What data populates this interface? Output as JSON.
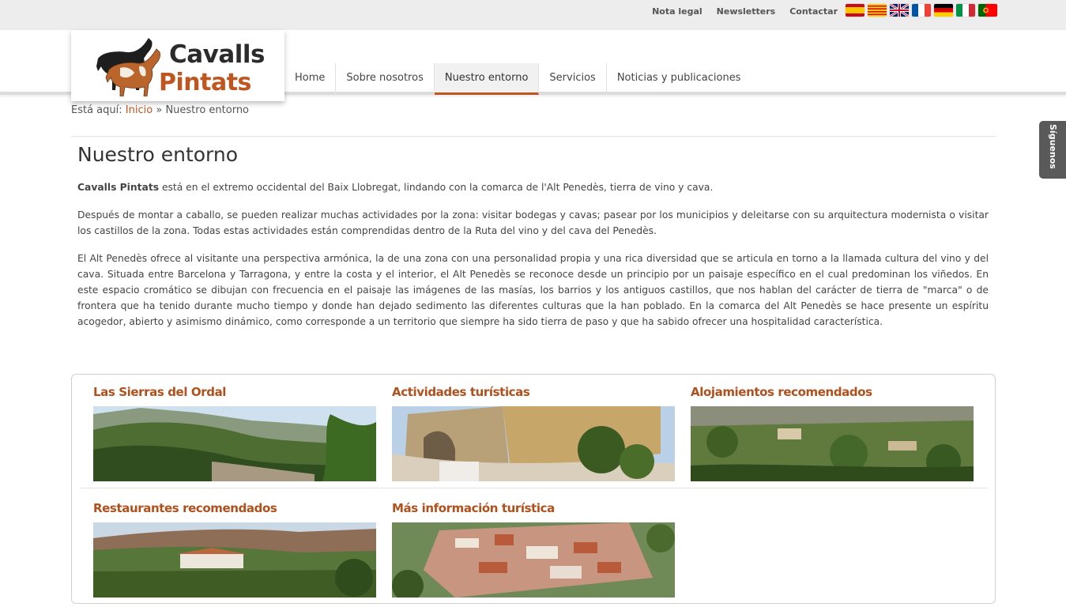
{
  "toplinks": [
    "Nota legal",
    "Newsletters",
    "Contactar"
  ],
  "flags": [
    "spanish-flag-icon",
    "catalan-flag-icon",
    "uk-flag-icon",
    "french-flag-icon",
    "german-flag-icon",
    "italian-flag-icon",
    "portuguese-flag-icon"
  ],
  "logo": {
    "line1": "Cavalls",
    "line2": "Pintats"
  },
  "nav": [
    "Home",
    "Sobre nosotros",
    "Nuestro entorno",
    "Servicios",
    "Noticias y publicaciones"
  ],
  "nav_active": "Nuestro entorno",
  "breadcrumb": {
    "prefix": "Está aquí:",
    "home": "Inicio",
    "sep": "»",
    "current": "Nuestro entorno"
  },
  "page": {
    "title": "Nuestro entorno",
    "p1_bold": "Cavalls Pintats",
    "p1_rest": " está en el extremo occidental del Baix Llobregat, lindando con la comarca de l'Alt Penedès, tierra de vino y cava.",
    "p2": "Después de montar a caballo, se pueden realizar muchas actividades por la zona: visitar bodegas y cavas; pasear por los municipios y deleitarse con su arquitectura modernista o visitar los castillos de la zona. Todas estas actividades están comprendidas dentro de la Ruta del vino y del cava del Penedès.",
    "p3": "El Alt Penedès ofrece al visitante una perspectiva armónica, la de una zona con una personalidad propia y una rica diversidad que se articula en torno a la llamada cultura del vino y del cava. Situada entre Barcelona y Tarragona, y entre la costa y el interior, el Alt Penedès se reconoce desde un principio por un paisaje específico en el cual predominan los viñedos. En este espacio cromático se dibujan con frecuencia en el paisaje las imágenes de las masías, los barrios y los antiguos castillos, que nos hablan del carácter de tierra de \"marca\" o de frontera que ha tenido durante mucho tiempo y donde han dejado sedimento las diferentes culturas que la han poblado. En la comarca del Alt Penedès se hace presente un espíritu acogedor, abierto y asimismo dinámico, como corresponde a un territorio que siempre ha sido tierra de paso y que ha sabido ofrecer una hospitalidad característica."
  },
  "cards": [
    {
      "title": "Las Sierras del Ordal"
    },
    {
      "title": "Actividades turísticas"
    },
    {
      "title": "Alojamientos recomendados"
    },
    {
      "title": "Restaurantes recomendados"
    },
    {
      "title": "Más información turística"
    }
  ],
  "follow": "Síguenos",
  "colors": {
    "accent": "#c0561f",
    "card_title": "#b0501c",
    "topbar": "#ededed"
  }
}
